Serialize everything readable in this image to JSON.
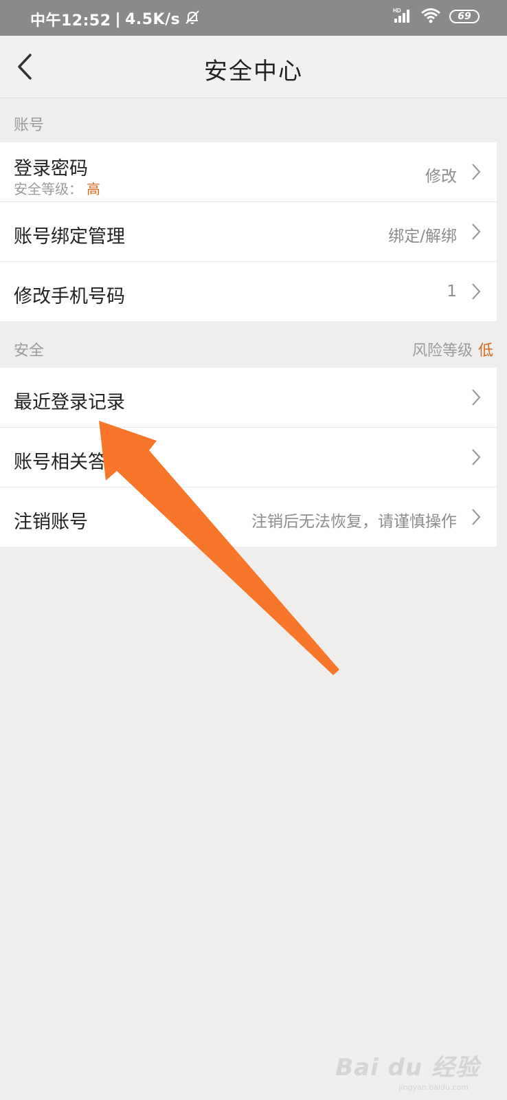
{
  "status_bar": {
    "time": "中午12:52",
    "separator": "|",
    "speed": "4.5K/s",
    "network_badge": "HD",
    "battery": "69"
  },
  "nav": {
    "title": "安全中心",
    "back_icon": "chevron-left-icon"
  },
  "sections": {
    "account": {
      "label": "账号",
      "items": [
        {
          "title": "登录密码",
          "sub_label": "安全等级：",
          "sub_level": "高",
          "value": "修改"
        },
        {
          "title": "账号绑定管理",
          "value": "绑定/解绑"
        },
        {
          "title": "修改手机号码",
          "value": "1"
        }
      ]
    },
    "security": {
      "label": "安全",
      "risk_label": "风险等级",
      "risk_value": "低",
      "items": [
        {
          "title": "最近登录记录",
          "value": ""
        },
        {
          "title": "账号相关答",
          "value": ""
        },
        {
          "title": "注销账号",
          "value": "注销后无法恢复，请谨慎操作"
        }
      ]
    }
  },
  "watermark": {
    "brand": "Bai du 经验",
    "url": "jingyan.baidu.com"
  },
  "colors": {
    "accent_orange": "#d66a1f",
    "annotation_arrow": "#f7762a",
    "status_bar_bg": "#8a8a8a",
    "page_bg": "#efeeed"
  }
}
